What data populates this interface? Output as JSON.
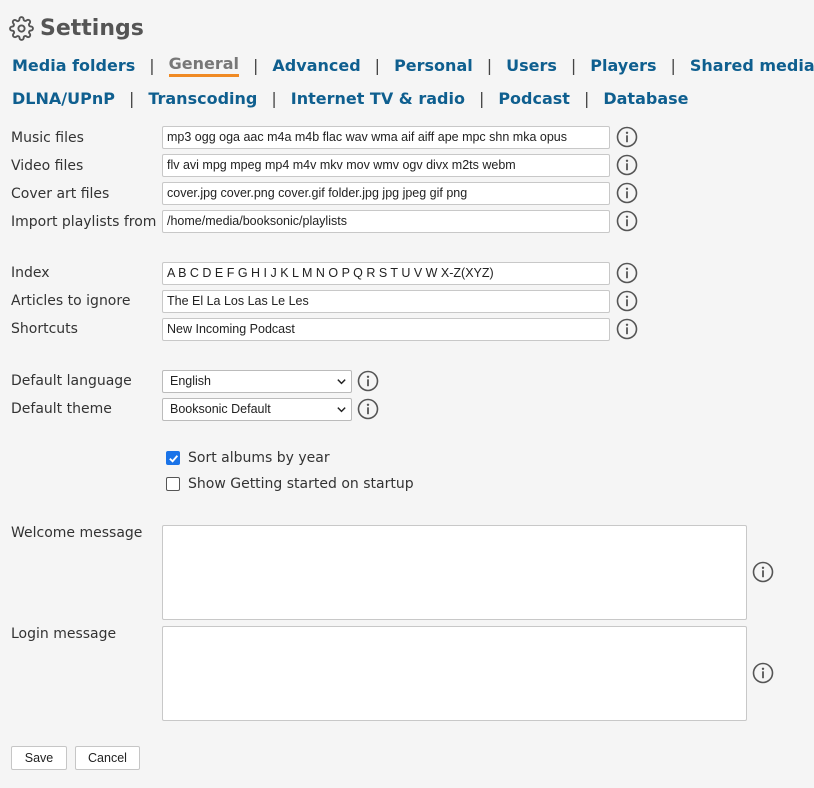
{
  "page": {
    "title": "Settings"
  },
  "nav": {
    "row1": [
      "Media folders",
      "General",
      "Advanced",
      "Personal",
      "Users",
      "Players",
      "Shared media"
    ],
    "row2": [
      "DLNA/UPnP",
      "Transcoding",
      "Internet TV & radio",
      "Podcast",
      "Database"
    ],
    "active": "General",
    "separator": "|"
  },
  "fields": {
    "music_files": {
      "label": "Music files",
      "value": "mp3 ogg oga aac m4a m4b flac wav wma aif aiff ape mpc shn mka opus"
    },
    "video_files": {
      "label": "Video files",
      "value": "flv avi mpg mpeg mp4 m4v mkv mov wmv ogv divx m2ts webm"
    },
    "cover_art_files": {
      "label": "Cover art files",
      "value": "cover.jpg cover.png cover.gif folder.jpg jpg jpeg gif png"
    },
    "import_playlists": {
      "label": "Import playlists from",
      "value": "/home/media/booksonic/playlists"
    },
    "index": {
      "label": "Index",
      "value": "A B C D E F G H I J K L M N O P Q R S T U V W X-Z(XYZ)"
    },
    "articles": {
      "label": "Articles to ignore",
      "value": "The El La Los Las Le Les"
    },
    "shortcuts": {
      "label": "Shortcuts",
      "value": "New Incoming Podcast"
    }
  },
  "selects": {
    "language": {
      "label": "Default language",
      "value": "English"
    },
    "theme": {
      "label": "Default theme",
      "value": "Booksonic Default"
    }
  },
  "checkboxes": {
    "sort_by_year": {
      "label": "Sort albums by year",
      "checked": true
    },
    "getting_started": {
      "label": "Show Getting started on startup",
      "checked": false
    }
  },
  "messages": {
    "welcome": {
      "label": "Welcome message",
      "value": ""
    },
    "login": {
      "label": "Login message",
      "value": ""
    }
  },
  "buttons": {
    "save": "Save",
    "cancel": "Cancel"
  },
  "colors": {
    "link": "#0f5f8f",
    "active_underline": "#f08a24",
    "checkbox": "#1a73e8"
  },
  "icons": {
    "title": "gear-icon",
    "help": "info-icon",
    "dropdown": "chevron-down-icon"
  }
}
